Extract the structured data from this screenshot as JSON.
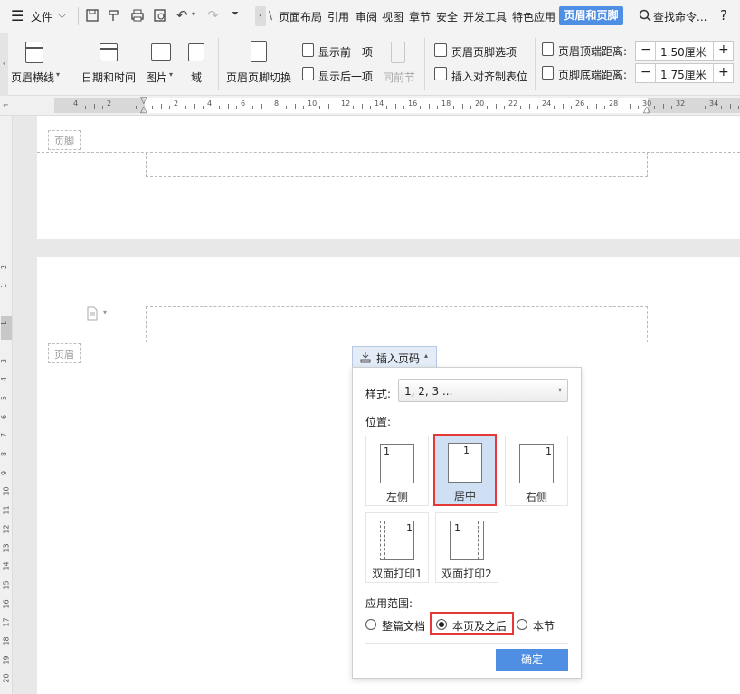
{
  "menubar": {
    "file_label": "文件",
    "tabs": [
      "页面布局",
      "引用",
      "审阅",
      "视图",
      "章节",
      "安全",
      "开发工具",
      "特色应用"
    ],
    "active_tab": "页眉和页脚",
    "search_label": "查找命令...",
    "help": "?"
  },
  "ribbon": {
    "header_line": "页眉横线",
    "date_time": "日期和时间",
    "picture": "图片",
    "field": "域",
    "switch": "页眉页脚切换",
    "show_prev": "显示前一项",
    "show_next": "显示后一项",
    "same_prev": "同前节",
    "options": "页眉页脚选项",
    "insert_tab": "插入对齐制表位",
    "header_top_label": "页眉顶端距离:",
    "header_top_value": "1.50厘米",
    "footer_bottom_label": "页脚底端距离:",
    "footer_bottom_value": "1.75厘米"
  },
  "ruler": {
    "h_ticks": [
      "4",
      "2",
      "",
      "2",
      "4",
      "6",
      "8",
      "10",
      "12",
      "14",
      "16",
      "18",
      "20",
      "22",
      "24",
      "26",
      "28",
      "30",
      "32",
      "34"
    ],
    "v_ticks": [
      "2",
      "1",
      "",
      "1",
      "",
      "3",
      "4",
      "5",
      "6",
      "7",
      "8",
      "9",
      "10",
      "11",
      "12",
      "13",
      "14",
      "15",
      "16",
      "17",
      "18",
      "19",
      "20"
    ]
  },
  "doc": {
    "footer_tag": "页脚",
    "header_tag": "页眉"
  },
  "popup": {
    "button_label": "插入页码",
    "style_label": "样式:",
    "style_value": "1, 2, 3 ...",
    "position_label": "位置:",
    "options": [
      {
        "label": "左侧",
        "num": "1"
      },
      {
        "label": "居中",
        "num": "1"
      },
      {
        "label": "右侧",
        "num": "1"
      },
      {
        "label": "双面打印1",
        "num": "1"
      },
      {
        "label": "双面打印2",
        "num": "1"
      }
    ],
    "scope_label": "应用范围:",
    "scopes": [
      "整篇文档",
      "本页及之后",
      "本节"
    ],
    "ok": "确定"
  }
}
